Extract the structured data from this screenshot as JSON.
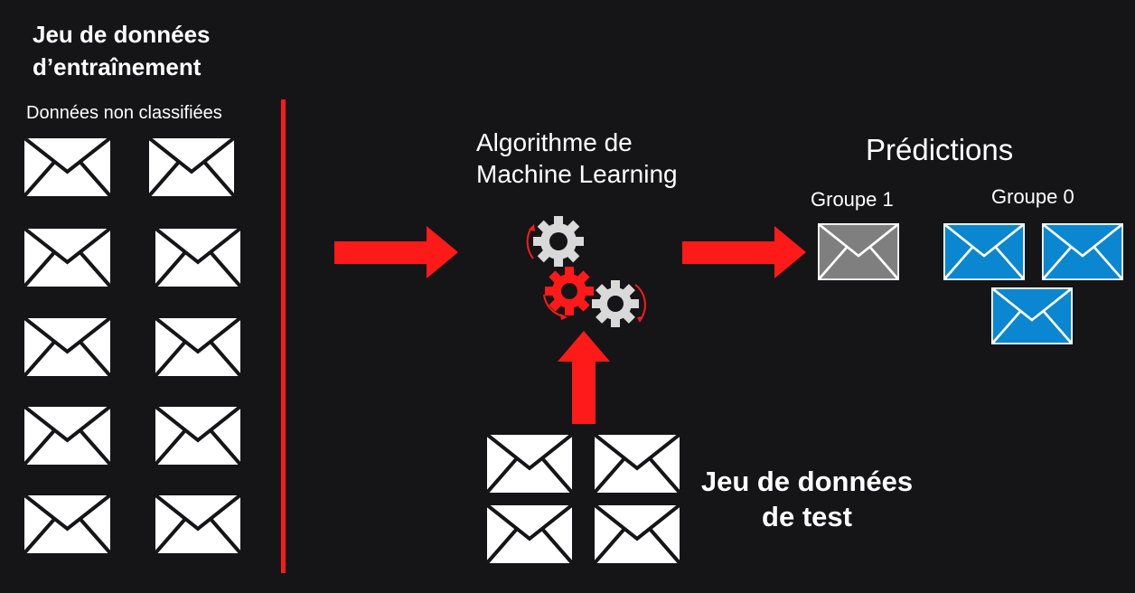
{
  "training": {
    "title_line1": "Jeu de données",
    "title_line2": "d’entraînement",
    "subtitle": "Données non classifiées"
  },
  "algorithm": {
    "line1": "Algorithme de",
    "line2": "Machine Learning"
  },
  "predictions": {
    "title": "Prédictions",
    "group1_label": "Groupe 1",
    "group0_label": "Groupe 0"
  },
  "test": {
    "title_line1": "Jeu de données",
    "title_line2": "de test"
  },
  "colors": {
    "background": "#151517",
    "accent_red": "#ff1a1a",
    "envelope_white": "#ffffff",
    "envelope_gray": "#7f7f7f",
    "envelope_blue": "#0b86d1",
    "gear_gray": "#d9d9d9"
  },
  "icons": {
    "envelope": "envelope-icon",
    "gear": "gear-icon",
    "arrow": "arrow-right-icon"
  }
}
